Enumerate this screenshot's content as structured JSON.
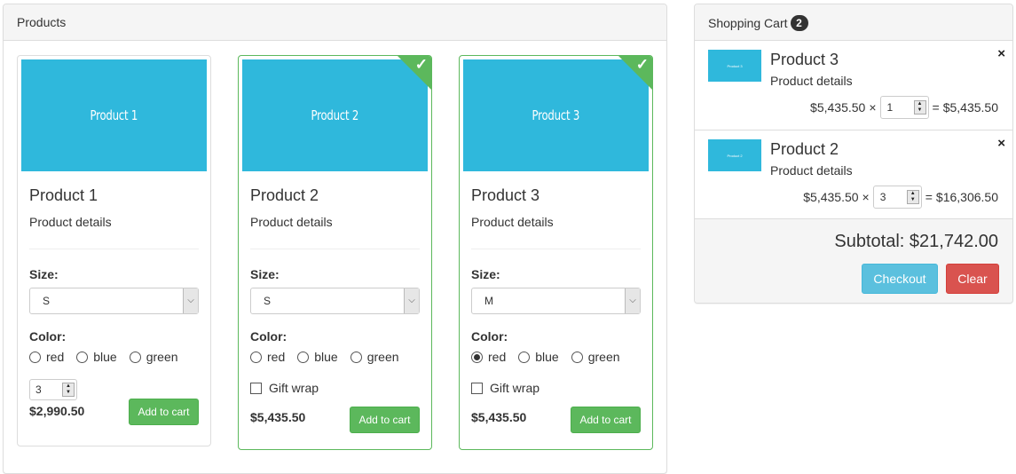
{
  "products_panel": {
    "title": "Products",
    "items": [
      {
        "image_label": "Product 1",
        "title": "Product 1",
        "details": "Product details",
        "size_label": "Size:",
        "size_value": "S",
        "color_label": "Color:",
        "colors": [
          "red",
          "blue",
          "green"
        ],
        "selected_color": null,
        "quantity": "3",
        "price": "$2,990.50",
        "add_button": "Add to cart",
        "in_cart": false
      },
      {
        "image_label": "Product 2",
        "title": "Product 2",
        "details": "Product details",
        "size_label": "Size:",
        "size_value": "S",
        "color_label": "Color:",
        "colors": [
          "red",
          "blue",
          "green"
        ],
        "selected_color": null,
        "gift_wrap_label": "Gift wrap",
        "gift_wrap_checked": false,
        "price": "$5,435.50",
        "add_button": "Add to cart",
        "in_cart": true
      },
      {
        "image_label": "Product 3",
        "title": "Product 3",
        "details": "Product details",
        "size_label": "Size:",
        "size_value": "M",
        "color_label": "Color:",
        "colors": [
          "red",
          "blue",
          "green"
        ],
        "selected_color": "red",
        "gift_wrap_label": "Gift wrap",
        "gift_wrap_checked": false,
        "price": "$5,435.50",
        "add_button": "Add to cart",
        "in_cart": true
      }
    ]
  },
  "cart": {
    "title": "Shopping Cart",
    "count": "2",
    "items": [
      {
        "thumb_label": "Product 3",
        "title": "Product 3",
        "details": "Product details",
        "unit_price": "$5,435.50",
        "times": "×",
        "quantity": "1",
        "equals": "=",
        "line_total": "$5,435.50",
        "remove": "×"
      },
      {
        "thumb_label": "Product 2",
        "title": "Product 2",
        "details": "Product details",
        "unit_price": "$5,435.50",
        "times": "×",
        "quantity": "3",
        "equals": "=",
        "line_total": "$16,306.50",
        "remove": "×"
      }
    ],
    "subtotal": "Subtotal: $21,742.00",
    "checkout_button": "Checkout",
    "clear_button": "Clear"
  },
  "icons": {
    "check": "✓",
    "chevron_down": "⌵",
    "spin_up": "▲",
    "spin_down": "▼"
  },
  "colors": {
    "accent_thumb": "#2fb8dc",
    "success": "#5cb85c",
    "info": "#5bc0de",
    "danger": "#d9534f"
  }
}
